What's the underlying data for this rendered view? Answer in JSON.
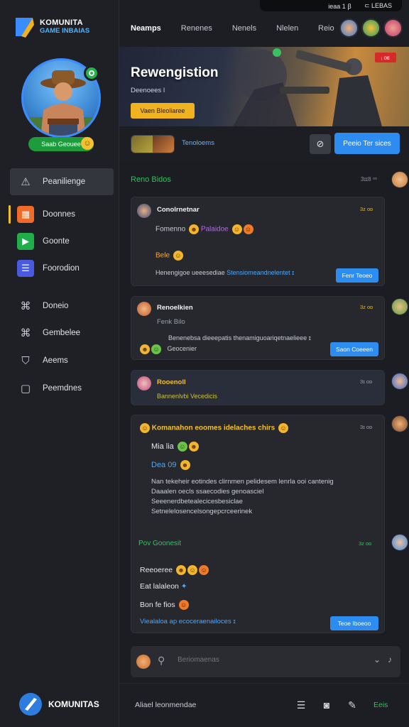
{
  "colors": {
    "accent_blue": "#2d8cf0",
    "accent_green": "#2fc25b",
    "accent_yellow": "#f0b21e",
    "background": "#1b1d22",
    "card": "#26282d"
  },
  "brand": {
    "line1": "KOMUNITA",
    "line2": "GAME INBAIAS",
    "footer_name": "KOMUNITAS"
  },
  "system": {
    "left": "ieaa 1 ꞵ",
    "right": "⊂ LEBAS"
  },
  "profile": {
    "status_label": "Saab Geouee",
    "status_emoji": "☺"
  },
  "sidebar": {
    "items": [
      {
        "label": "Peanilienge",
        "icon": "warning-icon"
      },
      {
        "label": "Doonnes",
        "icon": "grid-icon"
      },
      {
        "label": "Goonte",
        "icon": "play-icon"
      },
      {
        "label": "Foorodion",
        "icon": "list-icon"
      },
      {
        "label": "Doneio",
        "icon": "gamepad-icon"
      },
      {
        "label": "Gembelee",
        "icon": "gamepad-icon"
      },
      {
        "label": "Aeems",
        "icon": "shield-icon"
      },
      {
        "label": "Peemdnes",
        "icon": "book-icon"
      }
    ]
  },
  "topbar": {
    "tabs": [
      "Neamps",
      "Renenes",
      "Nenels",
      "Nlelen"
    ],
    "right_label": "Reio"
  },
  "banner": {
    "title": "Rewengistion",
    "subtitle": "Deenoees l",
    "button": "Vaen Bleoliaree",
    "badge": "ᵢ ᴏᴇ"
  },
  "action_row": {
    "label": "Tenoloems",
    "primary_button": "Peeio Ter sices"
  },
  "feed": {
    "title": "Reno Bidos",
    "time": "3ɪɪ8 ᵒᵒ",
    "cards": [
      {
        "name": "Conolrnetnar",
        "time": "3ᴢ ᴏᴅ",
        "line1": "Fomenno",
        "line1_tag": "Palaidoe",
        "line2": "Bele",
        "line3": "Henengigoe ueeesediae",
        "line3_link": "Stensiomeandnelentet ɪ",
        "button": "Fenr Teoeo"
      },
      {
        "name": "Renoelkien",
        "time": "3ᴢ ᴏᴅ",
        "line1": "Fenk Bilo",
        "line2": "Benenebsa dieeepatis thenamiguoariqetnaelieee ɪ",
        "line3": "Geocenier",
        "button": "Saon Coeeen"
      },
      {
        "name": "Rooenoll",
        "time": "3ɪ ᴏᴅ",
        "line1": "Bannenlvbi Vecedicis"
      },
      {
        "title": "Komanahon eoomes idelaches chirs",
        "time": "3ɪ ᴏᴅ",
        "line1": "Mia lia",
        "line2": "Dea 09",
        "para1": "Nan tekeheir eotindes clirnmen pelidesem lenrla ooi cantenig",
        "para2": "Daaalen oecls ssaecodies genoasciel",
        "para3": "Seeenerdbetealecicesbesiclae",
        "para4": "Setnelelosencelsongepcrceerinek",
        "section": "Pov Goonesit",
        "section_time": "3ᴢ ᴏᴅ",
        "item1": "Reeoeree",
        "item2": "Eat lalaleon",
        "item3": "Bon fe fios",
        "link": "Viealaloa ap ecoceraenailoces ɪ",
        "button": "Teoe Iboeoo"
      }
    ]
  },
  "comment": {
    "placeholder": "Beriomaenas"
  },
  "bottom_bar": {
    "label": "Aliael leonmendae",
    "green_label": "Eeis"
  }
}
